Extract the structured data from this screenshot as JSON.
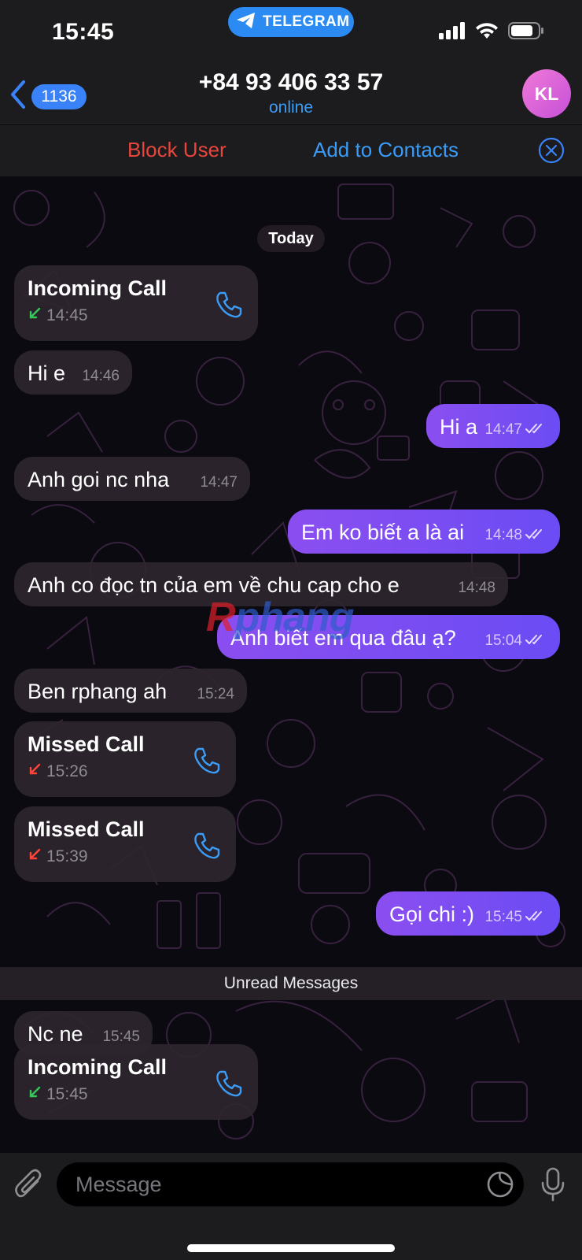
{
  "status_bar": {
    "time": "15:45",
    "app_pill": "TELEGRAM"
  },
  "header": {
    "back_count": "1136",
    "title": "+84 93 406 33 57",
    "subtitle": "online",
    "avatar_initials": "KL"
  },
  "action_bar": {
    "block_user": "Block User",
    "add_to_contacts": "Add to Contacts"
  },
  "chat": {
    "date_separator": "Today",
    "unread_separator": "Unread Messages",
    "messages": [
      {
        "kind": "call",
        "direction": "in",
        "title": "Incoming Call",
        "time": "14:45",
        "status": "answered"
      },
      {
        "kind": "text",
        "direction": "in",
        "text": "Hi e",
        "time": "14:46"
      },
      {
        "kind": "text",
        "direction": "out",
        "text": "Hi a",
        "time": "14:47",
        "read": true
      },
      {
        "kind": "text",
        "direction": "in",
        "text": "Anh goi nc nha",
        "time": "14:47"
      },
      {
        "kind": "text",
        "direction": "out",
        "text": "Em ko biết a là ai",
        "time": "14:48",
        "read": true
      },
      {
        "kind": "text",
        "direction": "in",
        "text": "Anh co đọc tn của em về chu cap cho e",
        "time": "14:48"
      },
      {
        "kind": "text",
        "direction": "out",
        "text": "Anh biết em qua đâu ạ?",
        "time": "15:04",
        "read": true
      },
      {
        "kind": "text",
        "direction": "in",
        "text": "Ben rphang ah",
        "time": "15:24"
      },
      {
        "kind": "call",
        "direction": "in",
        "title": "Missed Call",
        "time": "15:26",
        "status": "missed"
      },
      {
        "kind": "call",
        "direction": "in",
        "title": "Missed Call",
        "time": "15:39",
        "status": "missed"
      },
      {
        "kind": "text",
        "direction": "out",
        "text": "Gọi chi :)",
        "time": "15:45",
        "read": true
      },
      {
        "kind": "text",
        "direction": "in",
        "text": "Nc ne",
        "time": "15:45"
      },
      {
        "kind": "call",
        "direction": "in",
        "title": "Incoming Call",
        "time": "15:45",
        "status": "answered"
      }
    ]
  },
  "watermark": {
    "r": "R",
    "rest": "phang"
  },
  "composer": {
    "placeholder": "Message"
  },
  "colors": {
    "accent_blue": "#3a9cf7",
    "danger_red": "#e8453d",
    "outgoing_start": "#8b4ef0",
    "outgoing_end": "#6b4cf4",
    "answered_green": "#34c759",
    "missed_red": "#ff453a"
  },
  "icons": [
    "telegram-plane-icon",
    "signal-icon",
    "wifi-icon",
    "battery-icon",
    "back-chevron-icon",
    "close-circle-icon",
    "phone-icon",
    "call-arrow-icon",
    "read-checks-icon",
    "paperclip-icon",
    "sticker-icon",
    "microphone-icon"
  ]
}
